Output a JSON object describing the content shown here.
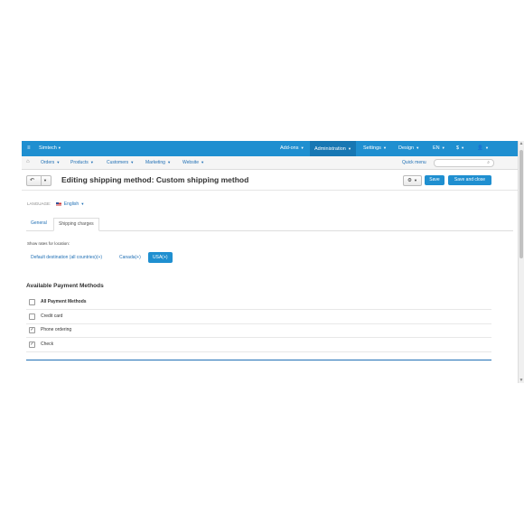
{
  "topbar": {
    "store": "Simtech",
    "menus": [
      "Add-ons",
      "Administration",
      "Settings",
      "Design",
      "EN",
      "$"
    ],
    "active_menu": "Administration",
    "user_icon": "user-icon"
  },
  "navbar": {
    "items": [
      "Orders",
      "Products",
      "Customers",
      "Marketing",
      "Website"
    ],
    "quick_menu": "Quick menu",
    "search_placeholder": ""
  },
  "header": {
    "title": "Editing shipping method: Custom shipping method",
    "save_label": "Save",
    "save_close_label": "Save and close"
  },
  "language": {
    "label": "LANGUAGE:",
    "value": "English"
  },
  "tabs": [
    "General",
    "Shipping charges"
  ],
  "active_tab": "Shipping charges",
  "rates": {
    "label": "Show rates for location:",
    "locations": [
      "Default destination (all countries)(+)",
      "Canada(+)",
      "USA(+)"
    ],
    "active": "USA(+)"
  },
  "payment": {
    "title": "Available Payment Methods",
    "all_label": "All Payment Methods",
    "methods": [
      {
        "label": "Credit card",
        "checked": false
      },
      {
        "label": "Phone ordering",
        "checked": true
      },
      {
        "label": "Check",
        "checked": true
      }
    ]
  },
  "colors": {
    "accent": "#1f8fd0",
    "topbar_active": "#1777b3",
    "link": "#1f6fb5"
  }
}
